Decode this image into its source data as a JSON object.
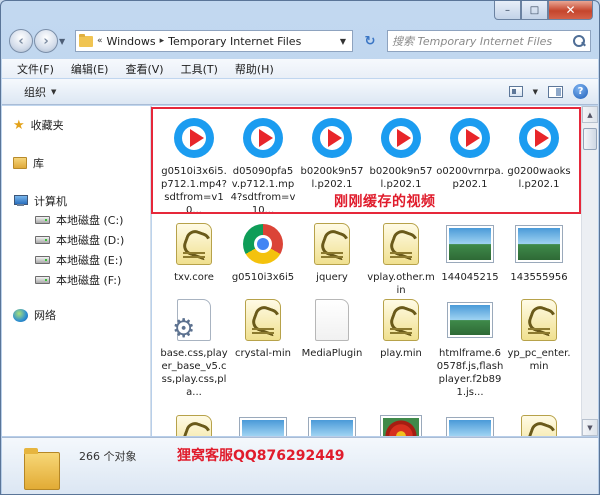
{
  "window": {
    "min_glyph": "–",
    "max_glyph": "□",
    "close_glyph": "✕"
  },
  "address": {
    "prefix": "«",
    "crumbs": [
      "Windows",
      "Temporary Internet Files"
    ],
    "search_placeholder": "搜索 Temporary Internet Files"
  },
  "menu": [
    "文件(F)",
    "编辑(E)",
    "查看(V)",
    "工具(T)",
    "帮助(H)"
  ],
  "command": {
    "organize_label": "组织"
  },
  "nav": {
    "favorites": "收藏夹",
    "libraries": "库",
    "computer": "计算机",
    "disks": [
      "本地磁盘 (C:)",
      "本地磁盘 (D:)",
      "本地磁盘 (E:)",
      "本地磁盘 (F:)"
    ],
    "network": "网络"
  },
  "files": {
    "row1": [
      {
        "label": "g0510i3x6i5.p712.1.mp4?sdtfrom=v10...",
        "icon": "video-player-icon"
      },
      {
        "label": "d05090pfa5v.p712.1.mp4?sdtfrom=v10...",
        "icon": "video-player-icon"
      },
      {
        "label": "b0200k9n57l.p202.1",
        "icon": "video-player-icon"
      },
      {
        "label": "b0200k9n57l.p202.1",
        "icon": "video-player-icon"
      },
      {
        "label": "o0200vrnrpa.p202.1",
        "icon": "video-player-icon"
      },
      {
        "label": "g0200waoksl.p202.1",
        "icon": "video-player-icon"
      }
    ],
    "row2": [
      {
        "label": "txv.core",
        "icon": "script-file-icon"
      },
      {
        "label": "g0510i3x6i5",
        "icon": "chrome-icon"
      },
      {
        "label": "jquery",
        "icon": "script-file-icon"
      },
      {
        "label": "vplay.other.min",
        "icon": "script-file-icon"
      },
      {
        "label": "144045215",
        "icon": "image-file-icon"
      },
      {
        "label": "143555956",
        "icon": "image-file-icon"
      }
    ],
    "row3": [
      {
        "label": "base.css,player_base_v5.css,play.css,pla...",
        "icon": "settings-file-icon"
      },
      {
        "label": "crystal-min",
        "icon": "script-file-icon"
      },
      {
        "label": "MediaPlugin",
        "icon": "blank-file-icon"
      },
      {
        "label": "play.min",
        "icon": "script-file-icon"
      },
      {
        "label": "htmlframe.60578f.js,flashplayer.f2b891.js...",
        "icon": "image-file-icon"
      },
      {
        "label": "yp_pc_enter.min",
        "icon": "script-file-icon"
      }
    ],
    "row4": [
      {
        "label": "",
        "icon": "script-file-icon"
      },
      {
        "label": "",
        "icon": "image-file-icon"
      },
      {
        "label": "",
        "icon": "image-file-icon"
      },
      {
        "label": "",
        "icon": "flower-image-icon"
      },
      {
        "label": "",
        "icon": "image-file-icon"
      },
      {
        "label": "",
        "icon": "script-file-icon"
      }
    ]
  },
  "annotations": {
    "cache_label": "刚刚缓存的视频",
    "watermark": "狸窝客服QQ876292449"
  },
  "status": {
    "count": "266 个对象"
  },
  "colors": {
    "highlight": "#e6283a",
    "annotation_text": "#e01c2c",
    "video_icon_blue": "#1b9cf0"
  }
}
